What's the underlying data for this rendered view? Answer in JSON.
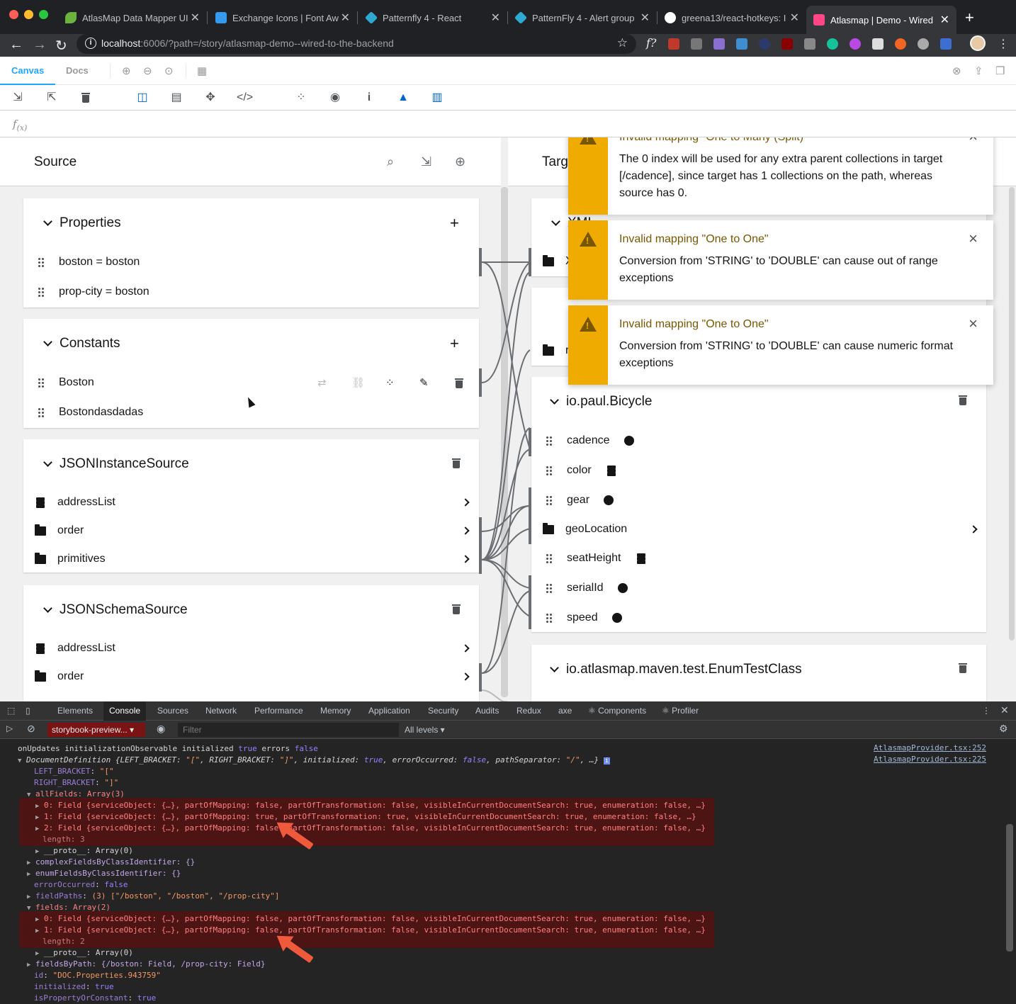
{
  "browser": {
    "tabs": [
      {
        "title": "AtlasMap Data Mapper UI",
        "color": "#6db33f"
      },
      {
        "title": "Exchange Icons | Font Aw",
        "color": "#339af0"
      },
      {
        "title": "Patternfly 4 - React",
        "color": "#2fa9d1"
      },
      {
        "title": "PatternFly 4 - Alert group",
        "color": "#2fa9d1"
      },
      {
        "title": "greena13/react-hotkeys: I",
        "color": "#ffffff"
      },
      {
        "title": "Atlasmap | Demo - Wired",
        "color": "#ff4785"
      }
    ],
    "url_host": "localhost",
    "url_rest": ":6006/?path=/story/atlasmap-demo--wired-to-the-backend"
  },
  "storybook": {
    "tab_canvas": "Canvas",
    "tab_docs": "Docs"
  },
  "expression": {
    "fx": "f",
    "fx_sub": "(x)"
  },
  "source": {
    "title": "Source",
    "cards": {
      "properties": {
        "title": "Properties",
        "rows": [
          "boston = boston",
          "prop-city = boston"
        ]
      },
      "constants": {
        "title": "Constants",
        "rows": [
          "Boston",
          "Bostondasdadas"
        ]
      },
      "json_instance": {
        "title": "JSONInstanceSource",
        "rows": [
          "addressList",
          "order",
          "primitives"
        ]
      },
      "json_schema": {
        "title": "JSONSchemaSource",
        "rows": [
          "addressList",
          "order"
        ]
      }
    }
  },
  "target": {
    "title": "Targ",
    "card1_title": "XML",
    "card1_row": "X",
    "card2_row": "r",
    "bicycle": {
      "title": "io.paul.Bicycle",
      "rows": [
        "cadence",
        "color",
        "gear",
        "geoLocation",
        "seatHeight",
        "serialId",
        "speed"
      ]
    },
    "enum": {
      "title": "io.atlasmap.maven.test.EnumTestClass"
    }
  },
  "alerts": [
    {
      "title": "Invalid mapping \"One to Many (Split)\"",
      "text": "The 0 index will be used for any extra parent collections in target [/cadence], since target has 1 collections on the path, whereas source has 0."
    },
    {
      "title": "Invalid mapping \"One to One\"",
      "text": "Conversion from 'STRING' to 'DOUBLE' can cause out of range exceptions"
    },
    {
      "title": "Invalid mapping \"One to One\"",
      "text": "Conversion from 'STRING' to 'DOUBLE' can cause numeric format exceptions"
    }
  ],
  "devtools": {
    "tabs": [
      "Elements",
      "Console",
      "Sources",
      "Network",
      "Performance",
      "Memory",
      "Application",
      "Security",
      "Audits",
      "Redux",
      "axe",
      "⚛ Components",
      "⚛ Profiler"
    ],
    "context": "storybook-preview...",
    "filter_placeholder": "Filter",
    "levels": "All levels ▾",
    "console": {
      "line1": {
        "a": "onUpdates initializationObservable initialized ",
        "b": "true",
        "c": " errors ",
        "d": "false",
        "src": "AtlasmapProvider.tsx:252"
      },
      "line2": {
        "a": "DocumentDefinition {LEFT_BRACKET: ",
        "b": "\"[\"",
        "c": ", RIGHT_BRACKET: ",
        "d": "\"]\"",
        "e": ", initialized: ",
        "f": "true",
        "g": ", errorOccurred: ",
        "h": "false",
        "i": ", pathSeparator: ",
        "j": "\"/\"",
        "k": ", …}",
        "src": "AtlasmapProvider.tsx:225"
      },
      "left_bracket": {
        "k": "LEFT_BRACKET",
        "v": "\"[\""
      },
      "right_bracket": {
        "k": "RIGHT_BRACKET",
        "v": "\"]\""
      },
      "allfields": "allFields: Array(3)",
      "allfields_items": [
        {
          "idx": "0",
          "mapping": "false",
          "transf": "false"
        },
        {
          "idx": "1",
          "mapping": "true",
          "transf": "true"
        },
        {
          "idx": "2",
          "mapping": "false",
          "transf": "false"
        }
      ],
      "field_prefix": ": Field {serviceObject: {…}, partOfMapping: ",
      "field_mid": ", partOfTransformation: ",
      "field_end": ", visibleInCurrentDocumentSearch: true, enumeration: false, …}",
      "length3": "length: 3",
      "proto": "__proto__: Array(0)",
      "complex": "complexFieldsByClassIdentifier: {}",
      "enumf": "enumFieldsByClassIdentifier: {}",
      "erroroccurred": {
        "k": "errorOccurred",
        "v": "false"
      },
      "fieldpaths": {
        "k": "fieldPaths",
        "v": "(3) [\"/boston\", \"/boston\", \"/prop-city\"]"
      },
      "fields": "fields: Array(2)",
      "fields_items": [
        {
          "idx": "0",
          "mapping": "false",
          "transf": "false"
        },
        {
          "idx": "1",
          "mapping": "false",
          "transf": "false"
        }
      ],
      "length2": "length: 2",
      "fieldsbypath": "fieldsByPath: {/boston: Field, /prop-city: Field}",
      "id": {
        "k": "id",
        "v": "\"DOC.Properties.943759\""
      },
      "initialized": {
        "k": "initialized",
        "v": "true"
      },
      "isprop": {
        "k": "isPropertyOrConstant",
        "v": "true"
      }
    }
  }
}
